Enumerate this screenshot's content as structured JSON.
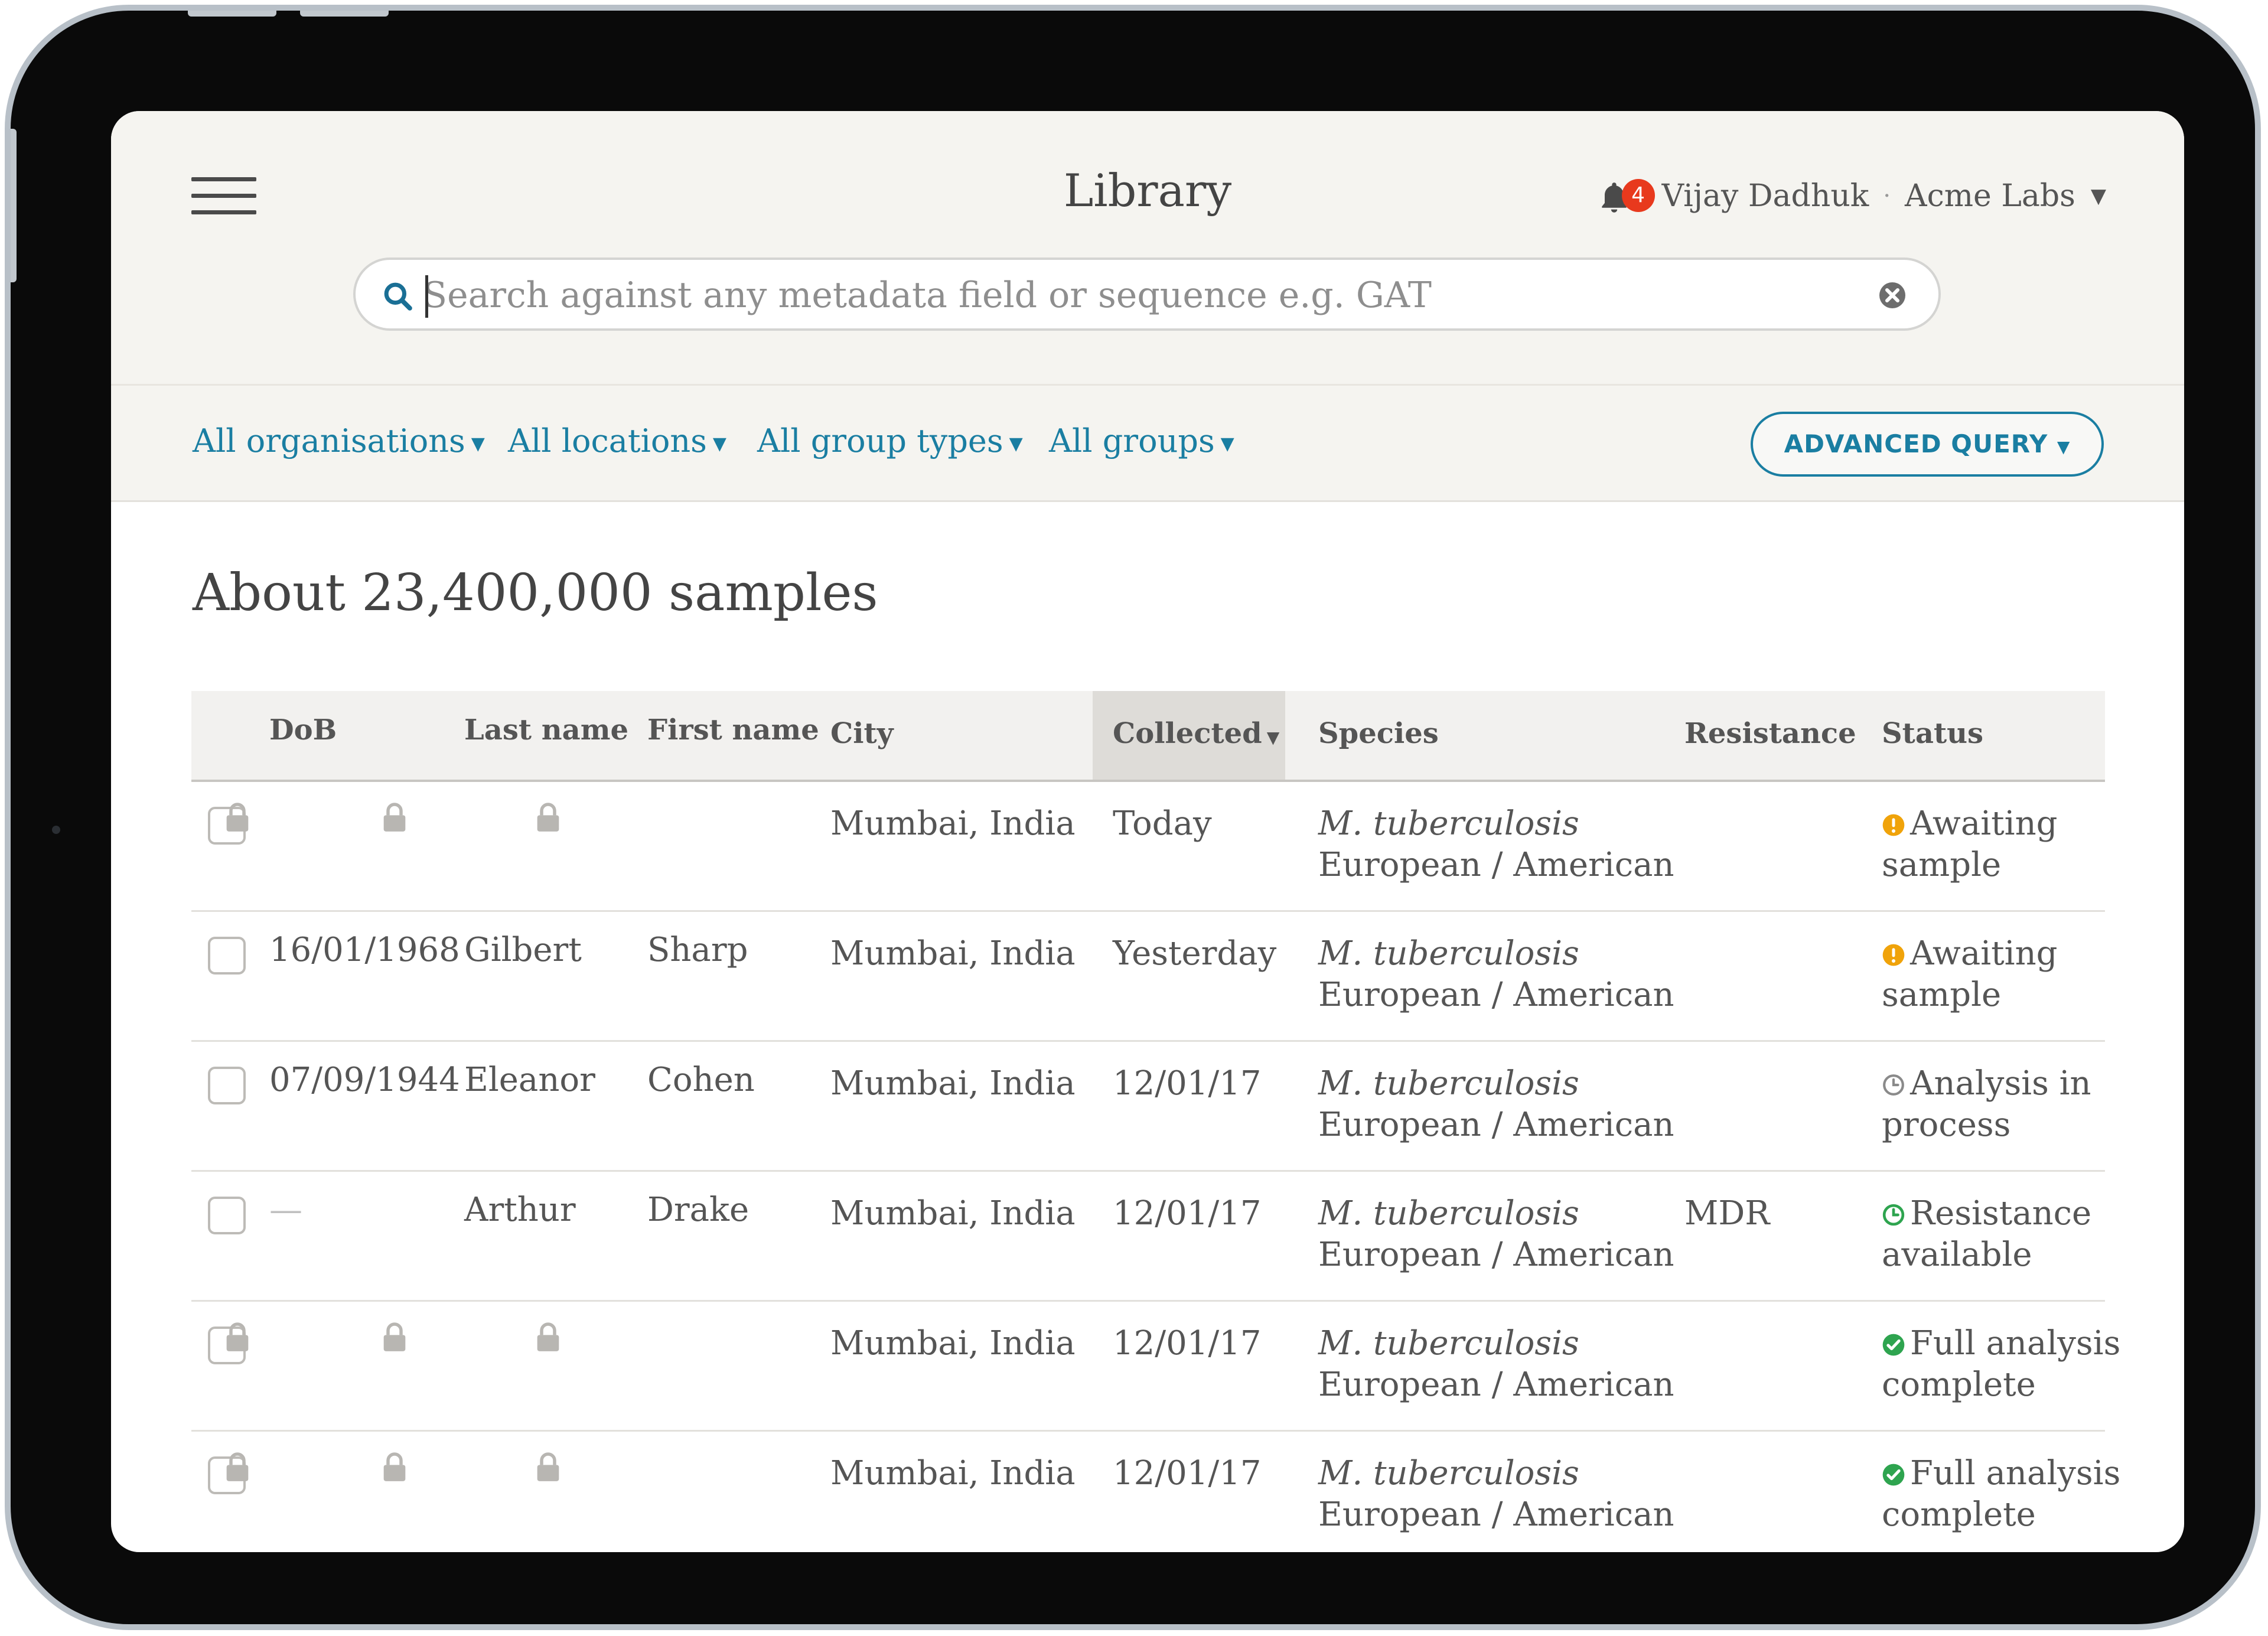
{
  "header": {
    "title": "Library",
    "notification_count": "4",
    "user_name": "Vijay Dadhuk",
    "separator": "·",
    "organisation": "Acme Labs"
  },
  "search": {
    "placeholder": "Search against any metadata field or sequence e.g. GAT",
    "value": ""
  },
  "filters": {
    "organisations": "All organisations",
    "locations": "All locations",
    "group_types": "All group types",
    "groups": "All groups",
    "advanced": "ADVANCED QUERY"
  },
  "summary": {
    "count_text": "About 23,400,000 samples"
  },
  "table": {
    "columns": {
      "dob": "DoB",
      "last_name": "Last name",
      "first_name": "First name",
      "city": "City",
      "collected": "Collected",
      "species": "Species",
      "resistance": "Resistance",
      "status": "Status"
    },
    "rows": [
      {
        "dob": "",
        "last_name": "",
        "first_name": "",
        "locked": true,
        "city": "Mumbai, India",
        "collected": "Today",
        "species": "M. tuberculosis",
        "lineage": "European / American",
        "resistance": "",
        "status_line1": "Awaiting",
        "status_line2": "sample",
        "status_type": "awaiting"
      },
      {
        "dob": "16/01/1968",
        "last_name": "Gilbert",
        "first_name": "Sharp",
        "locked": false,
        "city": "Mumbai, India",
        "collected": "Yesterday",
        "species": "M. tuberculosis",
        "lineage": "European / American",
        "resistance": "",
        "status_line1": "Awaiting",
        "status_line2": "sample",
        "status_type": "awaiting"
      },
      {
        "dob": "07/09/1944",
        "last_name": "Eleanor",
        "first_name": "Cohen",
        "locked": false,
        "city": "Mumbai, India",
        "collected": "12/01/17",
        "species": "M. tuberculosis",
        "lineage": "European / American",
        "resistance": "",
        "status_line1": "Analysis in",
        "status_line2": "process",
        "status_type": "processing"
      },
      {
        "dob": "—",
        "last_name": "Arthur",
        "first_name": "Drake",
        "locked": false,
        "city": "Mumbai, India",
        "collected": "12/01/17",
        "species": "M. tuberculosis",
        "lineage": "European / American",
        "resistance": "MDR",
        "status_line1": "Resistance",
        "status_line2": "available",
        "status_type": "resistance"
      },
      {
        "dob": "",
        "last_name": "",
        "first_name": "",
        "locked": true,
        "city": "Mumbai, India",
        "collected": "12/01/17",
        "species": "M. tuberculosis",
        "lineage": "European / American",
        "resistance": "",
        "status_line1": "Full analysis",
        "status_line2": "complete",
        "status_type": "complete"
      },
      {
        "dob": "",
        "last_name": "",
        "first_name": "",
        "locked": true,
        "city": "Mumbai, India",
        "collected": "12/01/17",
        "species": "M. tuberculosis",
        "lineage": "European / American",
        "resistance": "",
        "status_line1": "Full analysis",
        "status_line2": "complete",
        "status_type": "complete"
      }
    ]
  },
  "colors": {
    "accent": "#1a7ea2",
    "badge": "#e8391d",
    "awaiting": "#f0a30a",
    "processing": "#8a8a8a",
    "complete": "#2ea44f"
  },
  "icons": {
    "menu": "hamburger-menu-icon",
    "bell": "bell-icon",
    "search": "search-icon",
    "clear": "clear-icon",
    "lock": "lock-icon",
    "awaiting": "exclamation-circle-icon",
    "processing": "clock-icon",
    "resistance": "clock-icon",
    "complete": "check-circle-icon"
  }
}
